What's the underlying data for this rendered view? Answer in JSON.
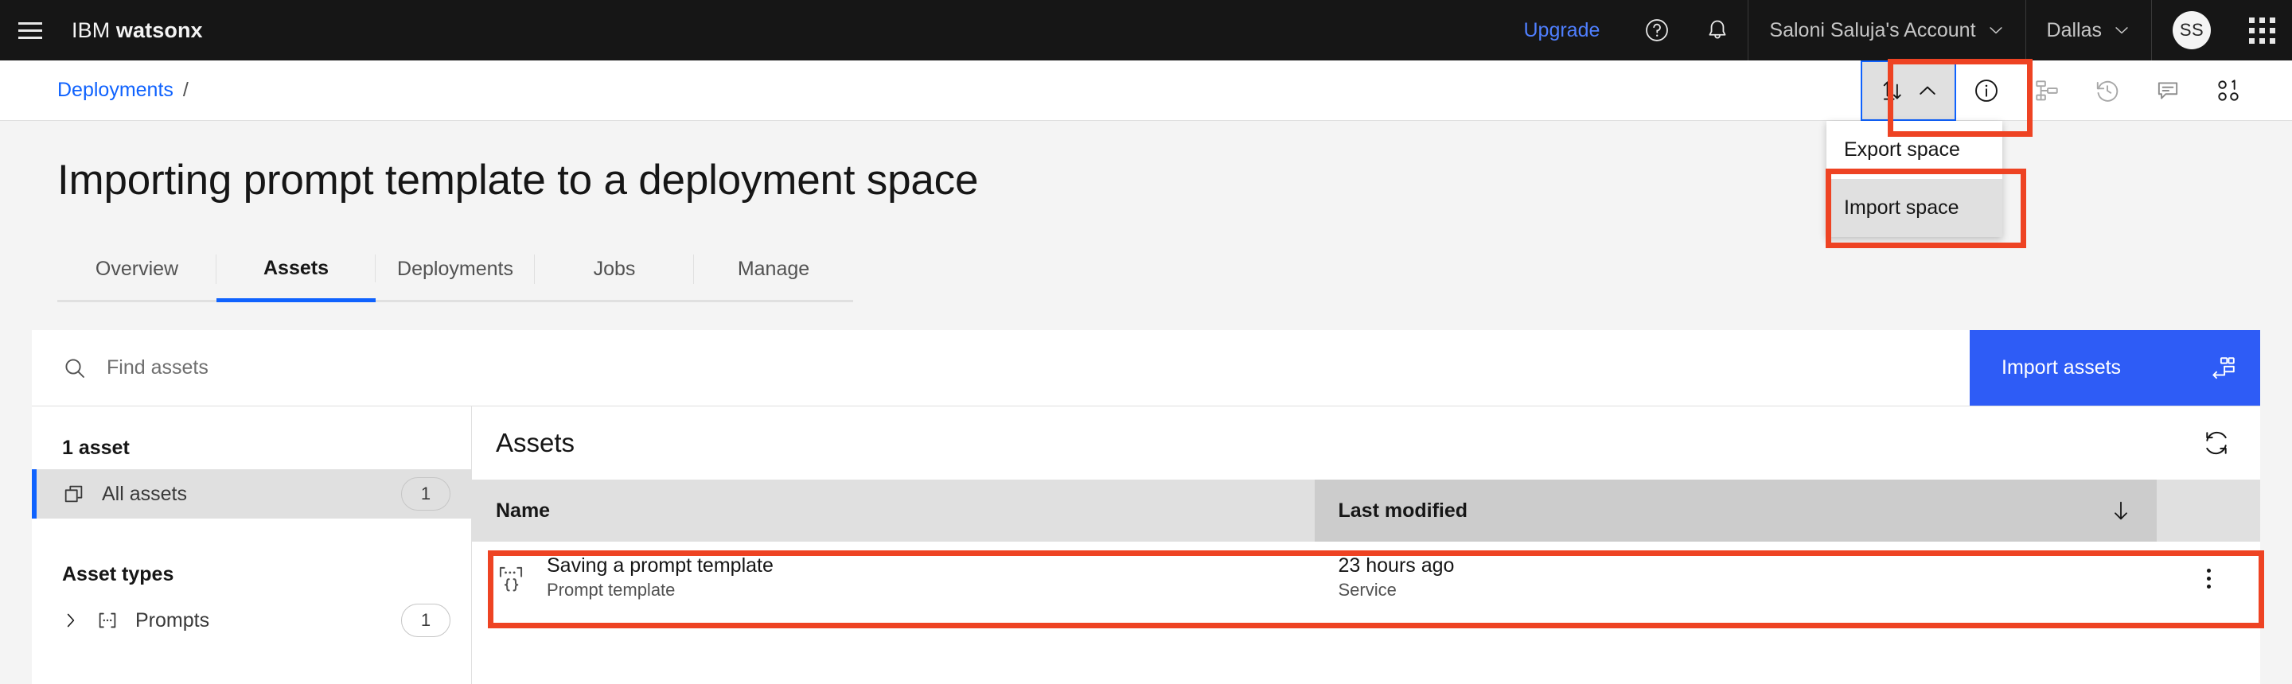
{
  "header": {
    "menu_icon": "hamburger-icon",
    "brand_prefix": "IBM",
    "brand_name": "watsonx",
    "upgrade_label": "Upgrade",
    "help_icon": "help-icon",
    "notifications_icon": "bell-icon",
    "account_label": "Saloni Saluja's Account",
    "region_label": "Dallas",
    "avatar_initials": "SS",
    "app_switcher_icon": "app-grid-icon"
  },
  "breadcrumb": {
    "items": [
      {
        "label": "Deployments",
        "link": true
      }
    ],
    "separator": "/"
  },
  "toolbar": {
    "import_export_icon": "import-export-icon",
    "chevron_icon": "chevron-up-icon",
    "icons": [
      {
        "name": "info-icon"
      },
      {
        "name": "sitemap-icon"
      },
      {
        "name": "history-icon"
      },
      {
        "name": "comment-icon"
      },
      {
        "name": "members-icon"
      }
    ]
  },
  "dropdown": {
    "items": [
      {
        "label": "Export space",
        "selected": false
      },
      {
        "label": "Import space",
        "selected": true
      }
    ]
  },
  "page": {
    "title": "Importing prompt template to a deployment space"
  },
  "tabs": [
    {
      "label": "Overview",
      "active": false
    },
    {
      "label": "Assets",
      "active": true
    },
    {
      "label": "Deployments",
      "active": false
    },
    {
      "label": "Jobs",
      "active": false
    },
    {
      "label": "Manage",
      "active": false
    }
  ],
  "search": {
    "icon": "search-icon",
    "placeholder": "Find assets",
    "value": ""
  },
  "import_assets_button": {
    "label": "Import assets",
    "icon": "import-assets-icon",
    "color": "#2e5cf6"
  },
  "sidebar": {
    "asset_count_label": "1 asset",
    "all_assets": {
      "label": "All assets",
      "icon": "copy-icon",
      "count": "1",
      "selected": true
    },
    "asset_types_label": "Asset types",
    "types": [
      {
        "label": "Prompts",
        "icon": "prompt-icon",
        "count": "1",
        "expand_icon": "chevron-right-icon"
      }
    ]
  },
  "assets_panel": {
    "title": "Assets",
    "refresh_icon": "refresh-icon",
    "columns": [
      {
        "label": "Name",
        "sorted": false
      },
      {
        "label": "Last modified",
        "sorted": true,
        "sort_direction": "desc",
        "sort_icon": "arrow-down-icon"
      }
    ],
    "rows": [
      {
        "icon": "prompt-template-icon",
        "name": "Saving a prompt template",
        "type": "Prompt template",
        "last_modified": "23 hours ago",
        "modified_by": "Service",
        "overflow_icon": "overflow-menu-icon"
      }
    ]
  },
  "annotations": {
    "highlight_color": "#ee4323",
    "boxes": [
      {
        "target": "import-export-toolbar-button"
      },
      {
        "target": "import-space-menu-item"
      },
      {
        "target": "assets-table-row"
      }
    ]
  }
}
